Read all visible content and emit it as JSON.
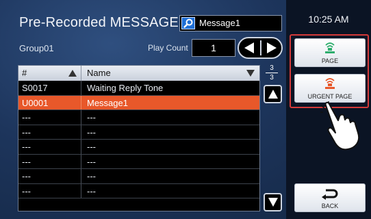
{
  "header": {
    "title": "Pre-Recorded MESSAGES",
    "search_value": "Message1",
    "search_icon": "search-icon"
  },
  "group": "Group01",
  "play_count": {
    "label": "Play Count",
    "value": "1"
  },
  "table": {
    "columns": [
      "#",
      "Name"
    ],
    "rows": [
      {
        "num": "S0017",
        "name": "Waiting Reply Tone",
        "selected": false
      },
      {
        "num": "U0001",
        "name": "Message1",
        "selected": true
      },
      {
        "num": "---",
        "name": "---",
        "selected": false
      },
      {
        "num": "---",
        "name": "---",
        "selected": false
      },
      {
        "num": "---",
        "name": "---",
        "selected": false
      },
      {
        "num": "---",
        "name": "---",
        "selected": false
      },
      {
        "num": "---",
        "name": "---",
        "selected": false
      },
      {
        "num": "---",
        "name": "---",
        "selected": false
      }
    ]
  },
  "pagination": {
    "current": "3",
    "total": "3"
  },
  "clock": "10:25 AM",
  "buttons": {
    "page": "PAGE",
    "urgent_page": "URGENT PAGE",
    "back": "BACK"
  },
  "colors": {
    "selected_row": "#e8582a",
    "page_icon": "#2fae6e",
    "urgent_icon": "#e8582a",
    "highlight": "#d53a3a"
  }
}
